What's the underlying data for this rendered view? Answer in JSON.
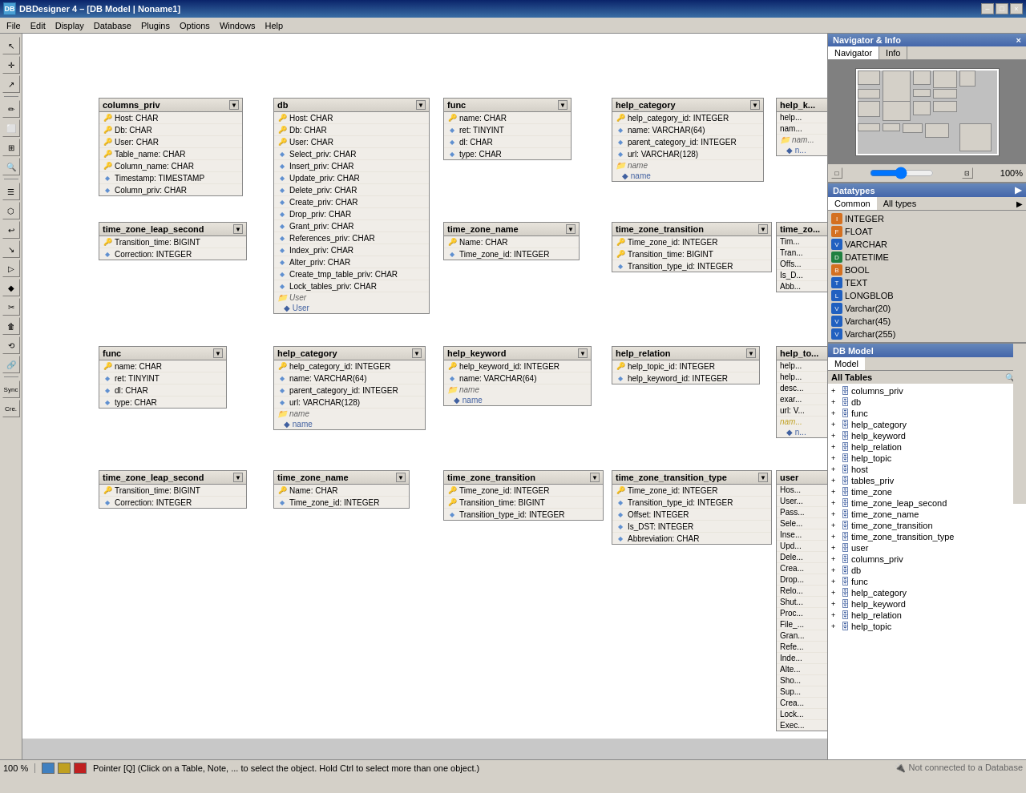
{
  "titleBar": {
    "title": "DBDesigner 4 – [DB Model | Noname1]",
    "minBtn": "–",
    "maxBtn": "□",
    "closeBtn": "×"
  },
  "menuBar": {
    "items": [
      "File",
      "Edit",
      "Display",
      "Database",
      "Plugins",
      "Options",
      "Windows",
      "Help"
    ]
  },
  "leftTools": {
    "tools": [
      "↖",
      "↕",
      "↗",
      "✏",
      "⬜",
      "⊞",
      "🔍",
      "☰",
      "⬡",
      "↩",
      "↘",
      "▷",
      "◆",
      "✂",
      "🗑",
      "⟲",
      "🔗",
      "Sync",
      "Cre."
    ]
  },
  "navigator": {
    "sectionTitle": "Navigator & Info",
    "tabs": [
      "Navigator",
      "Info"
    ],
    "zoom": "100%"
  },
  "datatypes": {
    "sectionTitle": "Datatypes",
    "tabs": [
      "Common",
      "All types"
    ],
    "items": [
      {
        "label": "INTEGER",
        "type": "orange"
      },
      {
        "label": "FLOAT",
        "type": "orange"
      },
      {
        "label": "VARCHAR",
        "type": "blue"
      },
      {
        "label": "DATETIME",
        "type": "green"
      },
      {
        "label": "BOOL",
        "type": "orange"
      },
      {
        "label": "TEXT",
        "type": "blue"
      },
      {
        "label": "LONGBLOB",
        "type": "blue"
      },
      {
        "label": "Varchar(20)",
        "type": "blue"
      },
      {
        "label": "Varchar(45)",
        "type": "blue"
      },
      {
        "label": "Varchar(255)",
        "type": "blue"
      }
    ]
  },
  "dbModel": {
    "sectionTitle": "DB Model",
    "tabs": [
      "Model"
    ],
    "treeHeader": "All Tables",
    "tables": [
      "columns_priv",
      "db",
      "func",
      "help_category",
      "help_keyword",
      "help_relation",
      "help_topic",
      "host",
      "tables_priv",
      "time_zone",
      "time_zone_leap_second",
      "time_zone_name",
      "time_zone_transition",
      "time_zone_transition_type",
      "user",
      "columns_priv",
      "db",
      "func",
      "help_category",
      "help_keyword",
      "help_relation",
      "help_topic"
    ]
  },
  "statusBar": {
    "zoom": "100 %",
    "message": "Pointer [Q] (Click on a Table, Note, ... to select the object. Hold Ctrl to select more than one object.)",
    "dbStatus": "Not connected to a Database"
  },
  "tables": {
    "columns_priv": {
      "title": "columns_priv",
      "fields": [
        {
          "icon": "key",
          "text": "Host: CHAR"
        },
        {
          "icon": "key",
          "text": "Db: CHAR"
        },
        {
          "icon": "key",
          "text": "User: CHAR"
        },
        {
          "icon": "key",
          "text": "Table_name: CHAR"
        },
        {
          "icon": "key",
          "text": "Column_name: CHAR"
        },
        {
          "icon": "diamond",
          "text": "Timestamp: TIMESTAMP"
        },
        {
          "icon": "diamond",
          "text": "Column_priv: CHAR"
        }
      ]
    },
    "db": {
      "title": "db",
      "fields": [
        {
          "icon": "key",
          "text": "Host: CHAR"
        },
        {
          "icon": "key",
          "text": "Db: CHAR"
        },
        {
          "icon": "key",
          "text": "User: CHAR"
        },
        {
          "icon": "diamond",
          "text": "Select_priv: CHAR"
        },
        {
          "icon": "diamond",
          "text": "Insert_priv: CHAR"
        },
        {
          "icon": "diamond",
          "text": "Update_priv: CHAR"
        },
        {
          "icon": "diamond",
          "text": "Delete_priv: CHAR"
        },
        {
          "icon": "diamond",
          "text": "Create_priv: CHAR"
        },
        {
          "icon": "diamond",
          "text": "Drop_priv: CHAR"
        },
        {
          "icon": "diamond",
          "text": "Grant_priv: CHAR"
        },
        {
          "icon": "diamond",
          "text": "References_priv: CHAR"
        },
        {
          "icon": "diamond",
          "text": "Index_priv: CHAR"
        },
        {
          "icon": "diamond",
          "text": "Alter_priv: CHAR"
        },
        {
          "icon": "diamond",
          "text": "Create_tmp_table_priv: CHAR"
        },
        {
          "icon": "diamond",
          "text": "Lock_tables_priv: CHAR"
        },
        {
          "icon": "folder",
          "text": "User"
        },
        {
          "icon": "name",
          "text": "User"
        }
      ]
    },
    "func": {
      "title": "func",
      "fields": [
        {
          "icon": "key",
          "text": "name: CHAR"
        },
        {
          "icon": "diamond",
          "text": "ret: TINYINT"
        },
        {
          "icon": "diamond",
          "text": "dl: CHAR"
        },
        {
          "icon": "diamond",
          "text": "type: CHAR"
        }
      ]
    },
    "help_category": {
      "title": "help_category",
      "fields": [
        {
          "icon": "key",
          "text": "help_category_id: INTEGER"
        },
        {
          "icon": "diamond",
          "text": "name: VARCHAR(64)"
        },
        {
          "icon": "diamond",
          "text": "parent_category_id: INTEGER"
        },
        {
          "icon": "diamond",
          "text": "url: VARCHAR(128)"
        },
        {
          "icon": "folder",
          "text": "name"
        },
        {
          "icon": "name",
          "text": "name"
        }
      ]
    },
    "time_zone_leap_second": {
      "title": "time_zone_leap_second",
      "fields": [
        {
          "icon": "key",
          "text": "Transition_time: BIGINT"
        },
        {
          "icon": "diamond",
          "text": "Correction: INTEGER"
        }
      ]
    },
    "time_zone_name": {
      "title": "time_zone_name",
      "fields": [
        {
          "icon": "key",
          "text": "Name: CHAR"
        },
        {
          "icon": "diamond",
          "text": "Time_zone_id: INTEGER"
        }
      ]
    },
    "time_zone_transition": {
      "title": "time_zone_transition",
      "fields": [
        {
          "icon": "key",
          "text": "Time_zone_id: INTEGER"
        },
        {
          "icon": "key",
          "text": "Transition_time: BIGINT"
        },
        {
          "icon": "diamond",
          "text": "Transition_type_id: INTEGER"
        }
      ]
    },
    "func2": {
      "title": "func",
      "fields": [
        {
          "icon": "key",
          "text": "name: CHAR"
        },
        {
          "icon": "diamond",
          "text": "ret: TINYINT"
        },
        {
          "icon": "diamond",
          "text": "dl: CHAR"
        },
        {
          "icon": "diamond",
          "text": "type: CHAR"
        }
      ]
    },
    "help_category2": {
      "title": "help_category",
      "fields": [
        {
          "icon": "key",
          "text": "help_category_id: INTEGER"
        },
        {
          "icon": "diamond",
          "text": "name: VARCHAR(64)"
        },
        {
          "icon": "diamond",
          "text": "parent_category_id: INTEGER"
        },
        {
          "icon": "diamond",
          "text": "url: VARCHAR(128)"
        },
        {
          "icon": "folder",
          "text": "name"
        },
        {
          "icon": "name",
          "text": "name"
        }
      ]
    },
    "help_keyword": {
      "title": "help_keyword",
      "fields": [
        {
          "icon": "key",
          "text": "help_keyword_id: INTEGER"
        },
        {
          "icon": "diamond",
          "text": "name: VARCHAR(64)"
        },
        {
          "icon": "folder",
          "text": "name"
        },
        {
          "icon": "name",
          "text": "name"
        }
      ]
    },
    "help_relation": {
      "title": "help_relation",
      "fields": [
        {
          "icon": "key",
          "text": "help_topic_id: INTEGER"
        },
        {
          "icon": "diamond",
          "text": "help_keyword_id: INTEGER"
        }
      ]
    },
    "time_zone_leap_second2": {
      "title": "time_zone_leap_second",
      "fields": [
        {
          "icon": "key",
          "text": "Transition_time: BIGINT"
        },
        {
          "icon": "diamond",
          "text": "Correction: INTEGER"
        }
      ]
    },
    "time_zone_name2": {
      "title": "time_zone_name",
      "fields": [
        {
          "icon": "key",
          "text": "Name: CHAR"
        },
        {
          "icon": "diamond",
          "text": "Time_zone_id: INTEGER"
        }
      ]
    },
    "time_zone_transition2": {
      "title": "time_zone_transition",
      "fields": [
        {
          "icon": "key",
          "text": "Time_zone_id: INTEGER"
        },
        {
          "icon": "key",
          "text": "Transition_time: BIGINT"
        },
        {
          "icon": "diamond",
          "text": "Transition_type_id: INTEGER"
        }
      ]
    },
    "time_zone_transition_type": {
      "title": "time_zone_transition_type",
      "fields": [
        {
          "icon": "key",
          "text": "Time_zone_id: INTEGER"
        },
        {
          "icon": "diamond",
          "text": "Transition_type_id: INTEGER"
        },
        {
          "icon": "diamond",
          "text": "Offset: INTEGER"
        },
        {
          "icon": "diamond",
          "text": "Is_DST: INTEGER"
        },
        {
          "icon": "diamond",
          "text": "Abbreviation: CHAR"
        }
      ]
    }
  }
}
